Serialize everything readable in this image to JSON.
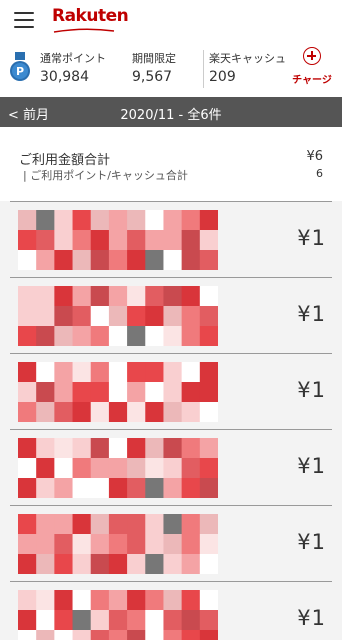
{
  "header": {
    "logo_text": "Rakuten",
    "brand_color": "#bf0000",
    "menu_icon": "hamburger-icon"
  },
  "points": {
    "icon": "rakuten-point-icon",
    "regular": {
      "label": "通常ポイント",
      "value": "30,984"
    },
    "limited": {
      "label": "期間限定",
      "value": "9,567"
    },
    "cash": {
      "label": "楽天キャッシュ",
      "value": "209"
    },
    "charge": {
      "label": "チャージ",
      "icon": "plus-circle-icon"
    }
  },
  "month_bar": {
    "prev_label": "< 前月",
    "title": "2020/11 - 全6件"
  },
  "summary": {
    "total_label": "ご利用金額合計",
    "total_value": "¥6",
    "points_label": "| ご利用ポイント/キャッシュ合計",
    "points_value": "6"
  },
  "transactions": [
    {
      "amount": "¥1"
    },
    {
      "amount": "¥1"
    },
    {
      "amount": "¥1"
    },
    {
      "amount": "¥1"
    },
    {
      "amount": "¥1"
    },
    {
      "amount": "¥1"
    }
  ]
}
